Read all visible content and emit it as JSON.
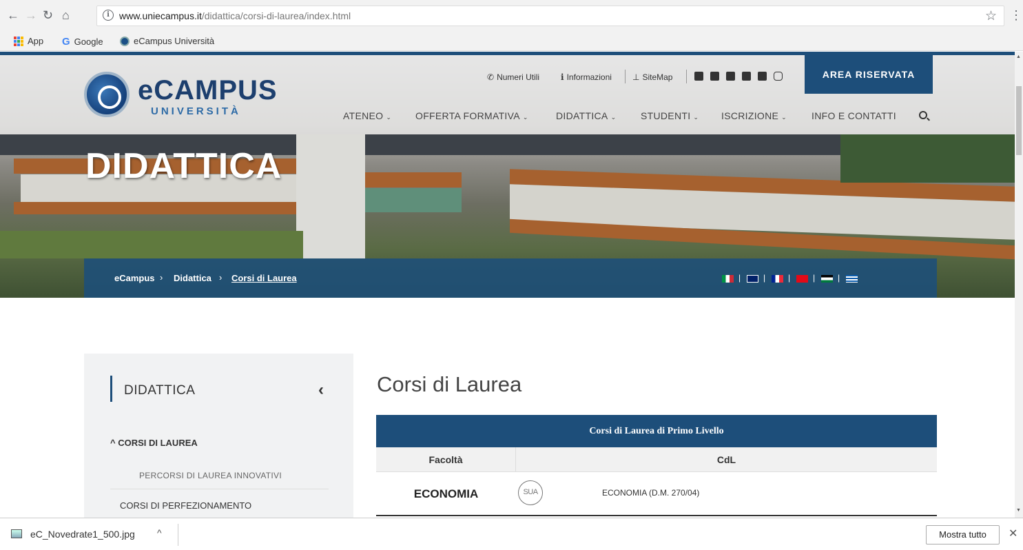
{
  "browser": {
    "url_host": "www.uniecampus.it",
    "url_path": "/didattica/corsi-di-laurea/index.html",
    "bookmarks": [
      "App",
      "Google",
      "eCampus Università"
    ]
  },
  "header": {
    "logo_text": "eCAMPUS",
    "logo_sub": "UNIVERSITÀ",
    "util_links": [
      "Numeri Utili",
      "Informazioni",
      "SiteMap"
    ],
    "area_riservata": "AREA RISERVATA",
    "nav": [
      "ATENEO",
      "OFFERTA FORMATIVA",
      "DIDATTICA",
      "STUDENTI",
      "ISCRIZIONE",
      "INFO E CONTATTI"
    ]
  },
  "hero": {
    "title": "DIDATTICA",
    "breadcrumb": [
      "eCampus",
      "Didattica",
      "Corsi di Laurea"
    ]
  },
  "sidebar": {
    "title": "DIDATTICA",
    "item1": "^ CORSI DI LAUREA",
    "sub1": "PERCORSI DI LAUREA INNOVATIVI",
    "item2": "CORSI DI PERFEZIONAMENTO"
  },
  "content": {
    "title": "Corsi di Laurea",
    "table_title": "Corsi di Laurea di Primo Livello",
    "col_faculty": "Facoltà",
    "col_cdl": "CdL",
    "row1_faculty": "ECONOMIA",
    "row1_badge": "SUA",
    "row1_cdl": "ECONOMIA (D.M. 270/04)"
  },
  "downloads": {
    "file": "eC_Novedrate1_500.jpg",
    "show_all": "Mostra tutto"
  }
}
